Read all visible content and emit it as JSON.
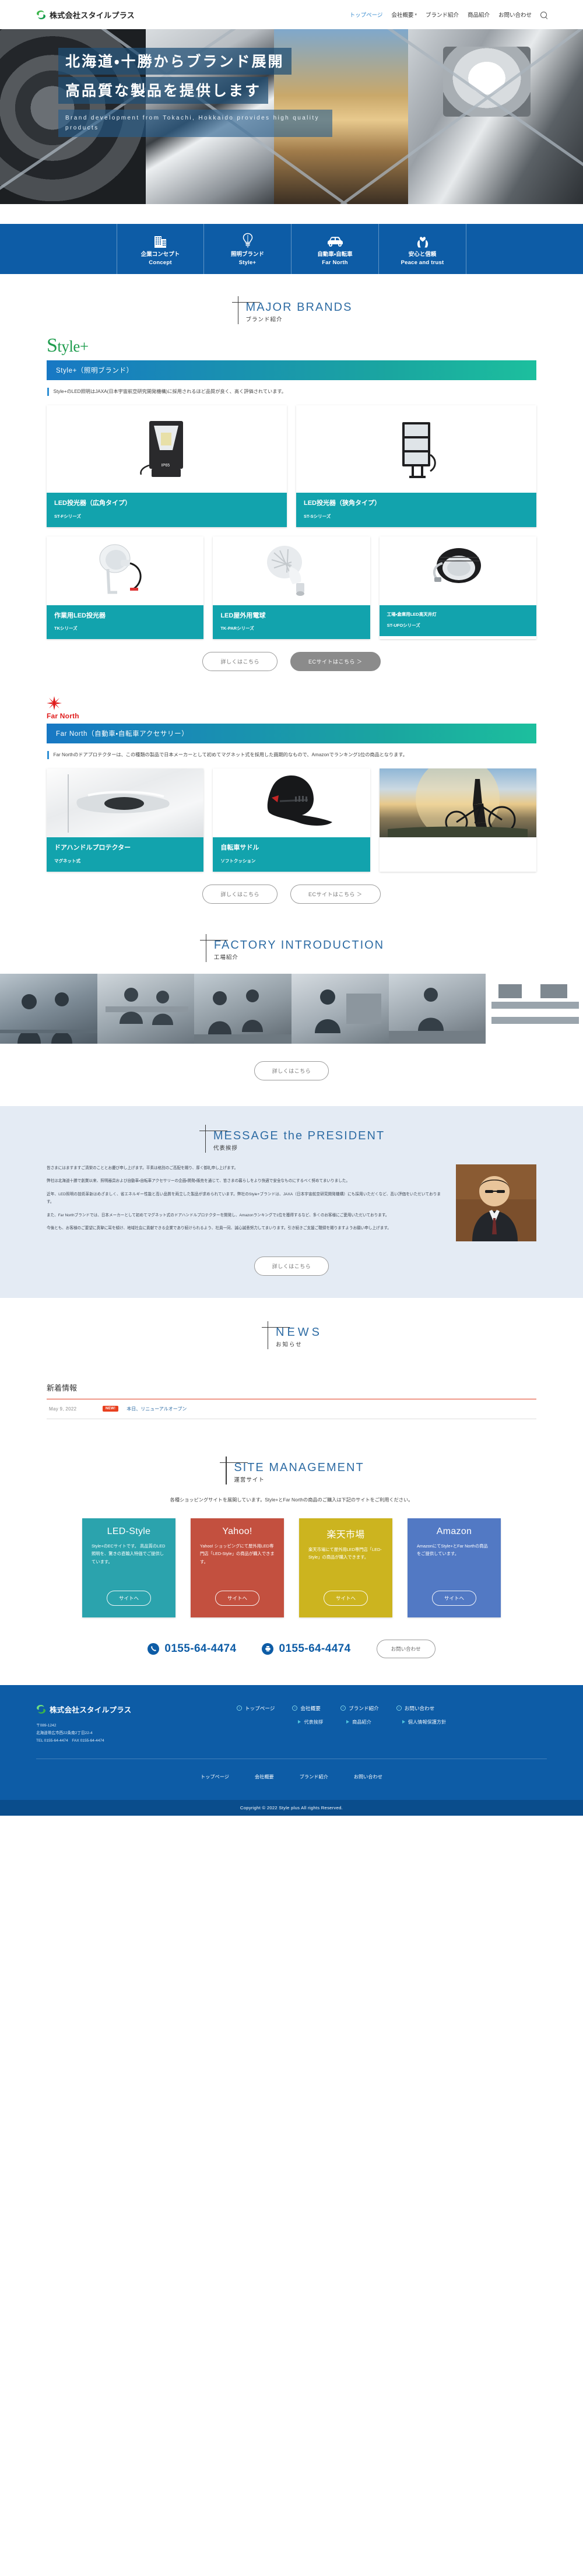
{
  "header": {
    "brand_name": "株式会社スタイルプラス",
    "nav": [
      {
        "label": "トップページ",
        "active": true,
        "caret": false
      },
      {
        "label": "会社概要",
        "active": false,
        "caret": true
      },
      {
        "label": "ブランド紹介",
        "active": false,
        "caret": false
      },
      {
        "label": "商品紹介",
        "active": false,
        "caret": false
      },
      {
        "label": "お問い合わせ",
        "active": false,
        "caret": false
      }
    ],
    "search_icon": "search-icon"
  },
  "hero": {
    "line1": "北海道・十勝からブランド展開",
    "line2": "高品質な製品を提供します",
    "subtitle": "Brand development from Tokachi, Hokkaido provides high quality products"
  },
  "concepts": [
    {
      "icon": "building-icon",
      "ja": "企業コンセプト",
      "en": "Concept"
    },
    {
      "icon": "lightbulb-icon",
      "ja": "照明ブランド",
      "en": "Style+"
    },
    {
      "icon": "car-icon",
      "ja": "自動車・自転車",
      "en": "Far North"
    },
    {
      "icon": "heart-hands-icon",
      "ja": "安心と信頼",
      "en": "Peace and trust"
    }
  ],
  "major_brands": {
    "heading_en": "MAJOR BRANDS",
    "heading_ja": "ブランド紹介",
    "style_plus": {
      "logo_text": "Style+",
      "bar_title": "Style+（照明ブランド）",
      "description": "Style+のLED照明はJAXA(日本宇宙航空研究開発機構)に採用されるほど品質が良く、高く評価されています。",
      "products_row1": [
        {
          "title": "LED投光器（広角タイプ）",
          "series": "ST-Fシリーズ",
          "image": "led-floodlight-wide"
        },
        {
          "title": "LED投光器（狭角タイプ）",
          "series": "ST-Sシリーズ",
          "image": "led-floodlight-narrow"
        }
      ],
      "products_row2": [
        {
          "title": "作業用LED投光器",
          "series": "TKシリーズ",
          "image": "work-led-floodlight"
        },
        {
          "title": "LED屋外用電球",
          "series": "TK-PARシリーズ",
          "image": "led-outdoor-bulb"
        },
        {
          "title": "工場・倉庫用LED高天井灯",
          "series": "ST-UFOシリーズ",
          "image": "led-highbay-ufo",
          "small_title": true
        }
      ],
      "btn_detail": "詳しくはこちら",
      "btn_ec": "ECサイトはこちら ＞"
    },
    "far_north": {
      "logo_text": "Far North",
      "bar_title": "Far North（自動車・自転車アクセサリー）",
      "description": "Far Northのドアプロテクターは、この種類の製品で日本メーカーとして初めてマグネット式を採用した画期的なもので、Amazonでランキング1位の商品となります。",
      "products": [
        {
          "title": "ドアハンドルプロテクター",
          "series": "マグネット式",
          "image": "car-door-handle-protector"
        },
        {
          "title": "自転車サドル",
          "series": "ソフトクッション",
          "image": "bicycle-saddle"
        }
      ],
      "btn_detail": "詳しくはこちら",
      "btn_ec": "ECサイトはこちら ＞"
    }
  },
  "factory": {
    "heading_en": "FACTORY INTRODUCTION",
    "heading_ja": "工場紹介",
    "photos": [
      "factory-photo-1",
      "factory-photo-2",
      "factory-photo-3",
      "factory-photo-4",
      "factory-photo-5",
      "factory-photo-6"
    ],
    "btn_detail": "詳しくはこちら"
  },
  "president": {
    "heading_en": "MESSAGE the PRESIDENT",
    "heading_ja": "代表挨拶",
    "photo": "president-portrait",
    "paragraphs": [
      "皆さまにはますますご清栄のこととお慶び申し上げます。平素は格別のご高配を賜り、厚く御礼申し上げます。",
      "弊社は北海道十勝で創業以来、照明器具および自動車・自転車アクセサリーの企画・開発・販売を通じて、皆さまの暮らしをより快適で安全なものにするべく努めてまいりました。",
      "近年、LED照明の技術革新はめざましく、省エネルギー性能と高い品質を両立した製品が求められています。弊社のStyle+ブランドは、JAXA（日本宇宙航空研究開発機構）にも採用いただくなど、高い評価をいただいております。",
      "また、Far Northブランドでは、日本メーカーとして初めてマグネット式のドアハンドルプロテクターを開発し、Amazonランキングで1位を獲得するなど、多くのお客様にご愛用いただいております。",
      "今後とも、お客様のご要望に真摯に耳を傾け、地域社会に貢献できる企業であり続けられるよう、社員一同、誠心誠意努力してまいります。引き続きご支援ご鞭撻を賜りますようお願い申し上げます。"
    ],
    "btn_detail": "詳しくはこちら"
  },
  "news": {
    "heading_en": "NEWS",
    "heading_ja": "お知らせ",
    "list_title": "新着情報",
    "items": [
      {
        "date": "May 9, 2022",
        "badge": "NEW!",
        "title": "本日、リニューアルオープン"
      }
    ]
  },
  "site_management": {
    "heading_en": "SITE MANAGEMENT",
    "heading_ja": "運営サイト",
    "lead": "各種ショッピングサイトを展開しています。Style+とFar Northの商品のご購入は下記のサイトをご利用ください。",
    "cards": [
      {
        "name": "LED-Style",
        "color": "#2ba3ad",
        "desc": "Style+のECサイトです。\n高品質のLED照明を、驚きの直輸入特価でご提供しています。",
        "btn": "サイトへ"
      },
      {
        "name": "Yahoo!",
        "color": "#c3503f",
        "desc": "Yahoo! ショッピングにて屋外用LED専門店「LED-Style」の商品が購入できます。",
        "btn": "サイトへ"
      },
      {
        "name": "楽天市場",
        "color": "#ccb41f",
        "desc": "楽天市場にて屋外用LED専門店「LED-Style」の商品が購入できます。",
        "btn": "サイトへ"
      },
      {
        "name": "Amazon",
        "color": "#5279c4",
        "desc": "AmazonにてStyle+とFar Northの商品をご提供しています。",
        "btn": "サイトへ"
      }
    ]
  },
  "contact": {
    "tel_icon": "phone-icon",
    "tel": "0155-64-4474",
    "fax_icon": "fax-icon",
    "fax": "0155-64-4474",
    "btn": "お問い合わせ"
  },
  "footer": {
    "brand_name": "株式会社スタイルプラス",
    "zip": "〒089-1242",
    "address": "北海道帯広市西22条南2丁目22-4",
    "phone_line": "TEL 0155-64-4474　FAX 0155-64-4474",
    "link_cols": [
      {
        "main": "トップページ",
        "sub": ""
      },
      {
        "main": "会社概要",
        "sub": "代表挨拶"
      },
      {
        "main": "ブランド紹介",
        "sub": "商品紹介"
      },
      {
        "main": "お問い合わせ",
        "sub": "個人情報保護方針"
      }
    ],
    "bottom_nav": [
      "トップページ",
      "会社概要",
      "ブランド紹介",
      "お問い合わせ"
    ],
    "copyright": "Copyright © 2022 Style plus All rights Reserved."
  },
  "colors": {
    "primary_blue": "#0d5ca6",
    "teal": "#12a3ad",
    "heading_blue": "#2e6ca4",
    "green_logo": "#1f9d4e",
    "red_far_north": "#e01b1b"
  }
}
